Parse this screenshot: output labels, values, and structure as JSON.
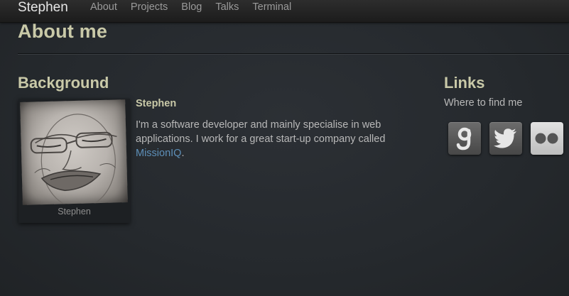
{
  "navbar": {
    "brand": "Stephen",
    "links": [
      "About",
      "Projects",
      "Blog",
      "Talks",
      "Terminal"
    ]
  },
  "page": {
    "title": "About me"
  },
  "background": {
    "heading": "Background",
    "photo_caption": "Stephen",
    "name": "Stephen",
    "bio_text": "I'm a software developer and mainly specialise in web applications. I work for a great start-up company called ",
    "bio_link": "MissionIQ",
    "bio_end": "."
  },
  "links": {
    "heading": "Links",
    "subtitle": "Where to find me",
    "icons": [
      "google-icon",
      "twitter-icon",
      "flickr-icon"
    ]
  },
  "colors": {
    "heading": "#c9c9a8",
    "link": "#5d8fb8",
    "background": "#262a2e"
  }
}
